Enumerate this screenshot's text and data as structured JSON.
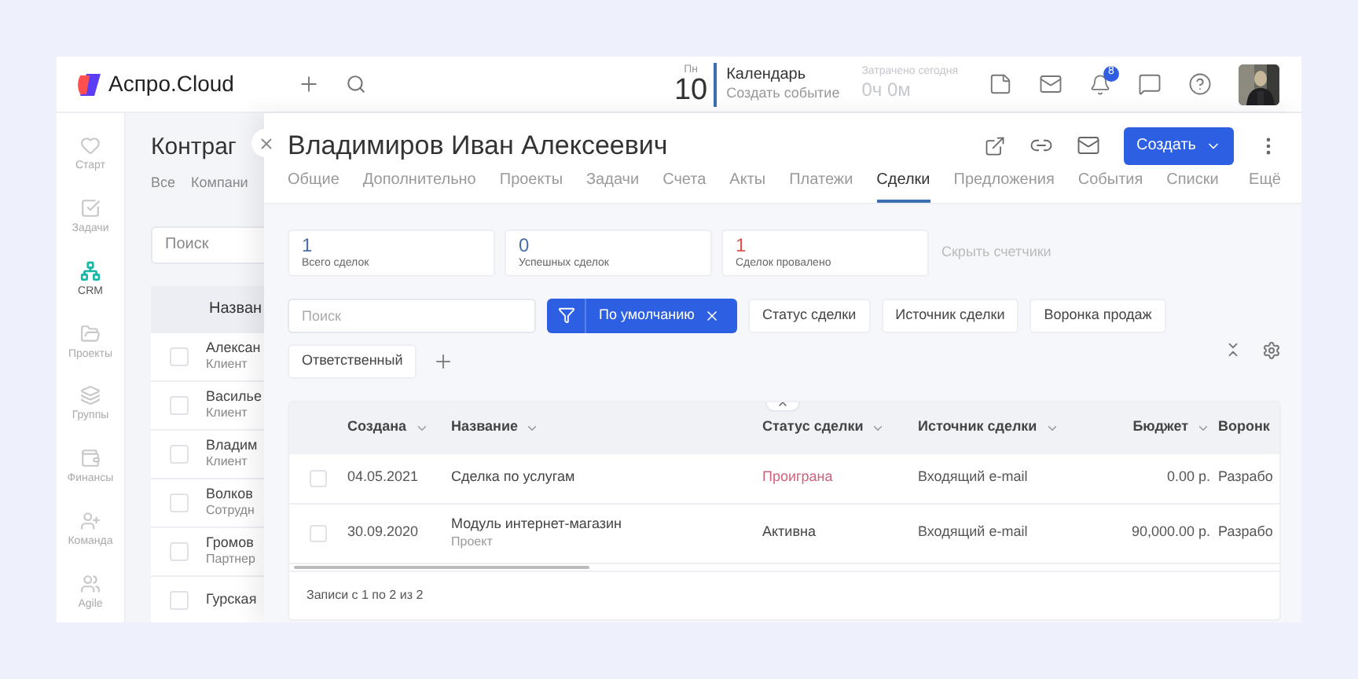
{
  "app": {
    "logo": "Аспро.Cloud"
  },
  "header": {
    "weekday": "Пн",
    "day": "10",
    "calendar_title": "Календарь",
    "calendar_action": "Создать событие",
    "time_label": "Затрачено сегодня",
    "time_value": "0ч 0м",
    "notifications": "8"
  },
  "sidebar": {
    "items": [
      {
        "label": "Старт",
        "selected": false
      },
      {
        "label": "Задачи",
        "selected": false
      },
      {
        "label": "CRM",
        "selected": true
      },
      {
        "label": "Проекты",
        "selected": false
      },
      {
        "label": "Группы",
        "selected": false
      },
      {
        "label": "Финансы",
        "selected": false
      },
      {
        "label": "Команда",
        "selected": false
      },
      {
        "label": "Agile",
        "selected": false
      }
    ]
  },
  "background_list": {
    "title": "Контраг",
    "tabs": [
      "Все",
      "Компани"
    ],
    "search": {
      "placeholder": "Поиск"
    },
    "column": "Назван",
    "rows": [
      {
        "name": "Алексан",
        "type": "Клиент",
        "checked": false
      },
      {
        "name": "Василье",
        "type": "Клиент",
        "checked": false
      },
      {
        "name": "Владим",
        "type": "Клиент",
        "checked": false
      },
      {
        "name": "Волков",
        "type": "Сотрудн",
        "checked": false
      },
      {
        "name": "Громов",
        "type": "Партнер",
        "checked": false
      },
      {
        "name": "Гурская",
        "checked": false
      }
    ]
  },
  "card": {
    "title": "Владимиров Иван Алексеевич",
    "create_button": "Создать",
    "tabs": [
      {
        "label": "Общие",
        "selected": false
      },
      {
        "label": "Дополнительно",
        "selected": false
      },
      {
        "label": "Проекты",
        "selected": false
      },
      {
        "label": "Задачи",
        "selected": false
      },
      {
        "label": "Счета",
        "selected": false
      },
      {
        "label": "Акты",
        "selected": false
      },
      {
        "label": "Платежи",
        "selected": false
      },
      {
        "label": "Сделки",
        "selected": true
      },
      {
        "label": "Предложения",
        "selected": false
      },
      {
        "label": "События",
        "selected": false
      },
      {
        "label": "Списки",
        "selected": false
      }
    ],
    "more_tab": "Ещё",
    "counters": [
      {
        "value": "1",
        "label": "Всего сделок",
        "color": "#4a6fa5"
      },
      {
        "value": "0",
        "label": "Успешных сделок",
        "color": "#4a6fa5"
      },
      {
        "value": "1",
        "label": "Сделок провалено",
        "color": "#d9534f"
      }
    ],
    "hide_counters": "Скрыть счетчики",
    "search": {
      "placeholder": "Поиск"
    },
    "active_filter": "По умолчанию",
    "filters": [
      "Статус сделки",
      "Источник сделки",
      "Воронка продаж",
      "Ответственный"
    ],
    "table": {
      "columns": [
        "Создана",
        "Название",
        "Статус сделки",
        "Источник сделки",
        "Бюджет",
        "Воронк"
      ],
      "rows": [
        {
          "checked": false,
          "created": "04.05.2021",
          "name": "Сделка по услугам",
          "status": {
            "text": "Проиграна",
            "kind": "lost"
          },
          "source": "Входящий e-mail",
          "budget": "0.00 р.",
          "funnel": "Разрабо"
        },
        {
          "checked": false,
          "created": "30.09.2020",
          "name": "Модуль интернет-магазин",
          "subtitle": "Проект",
          "status": {
            "text": "Активна",
            "kind": "active"
          },
          "source": "Входящий e-mail",
          "budget": "90,000.00 р.",
          "funnel": "Разрабо"
        }
      ],
      "footer": "Записи с 1 по 2 из 2"
    }
  }
}
